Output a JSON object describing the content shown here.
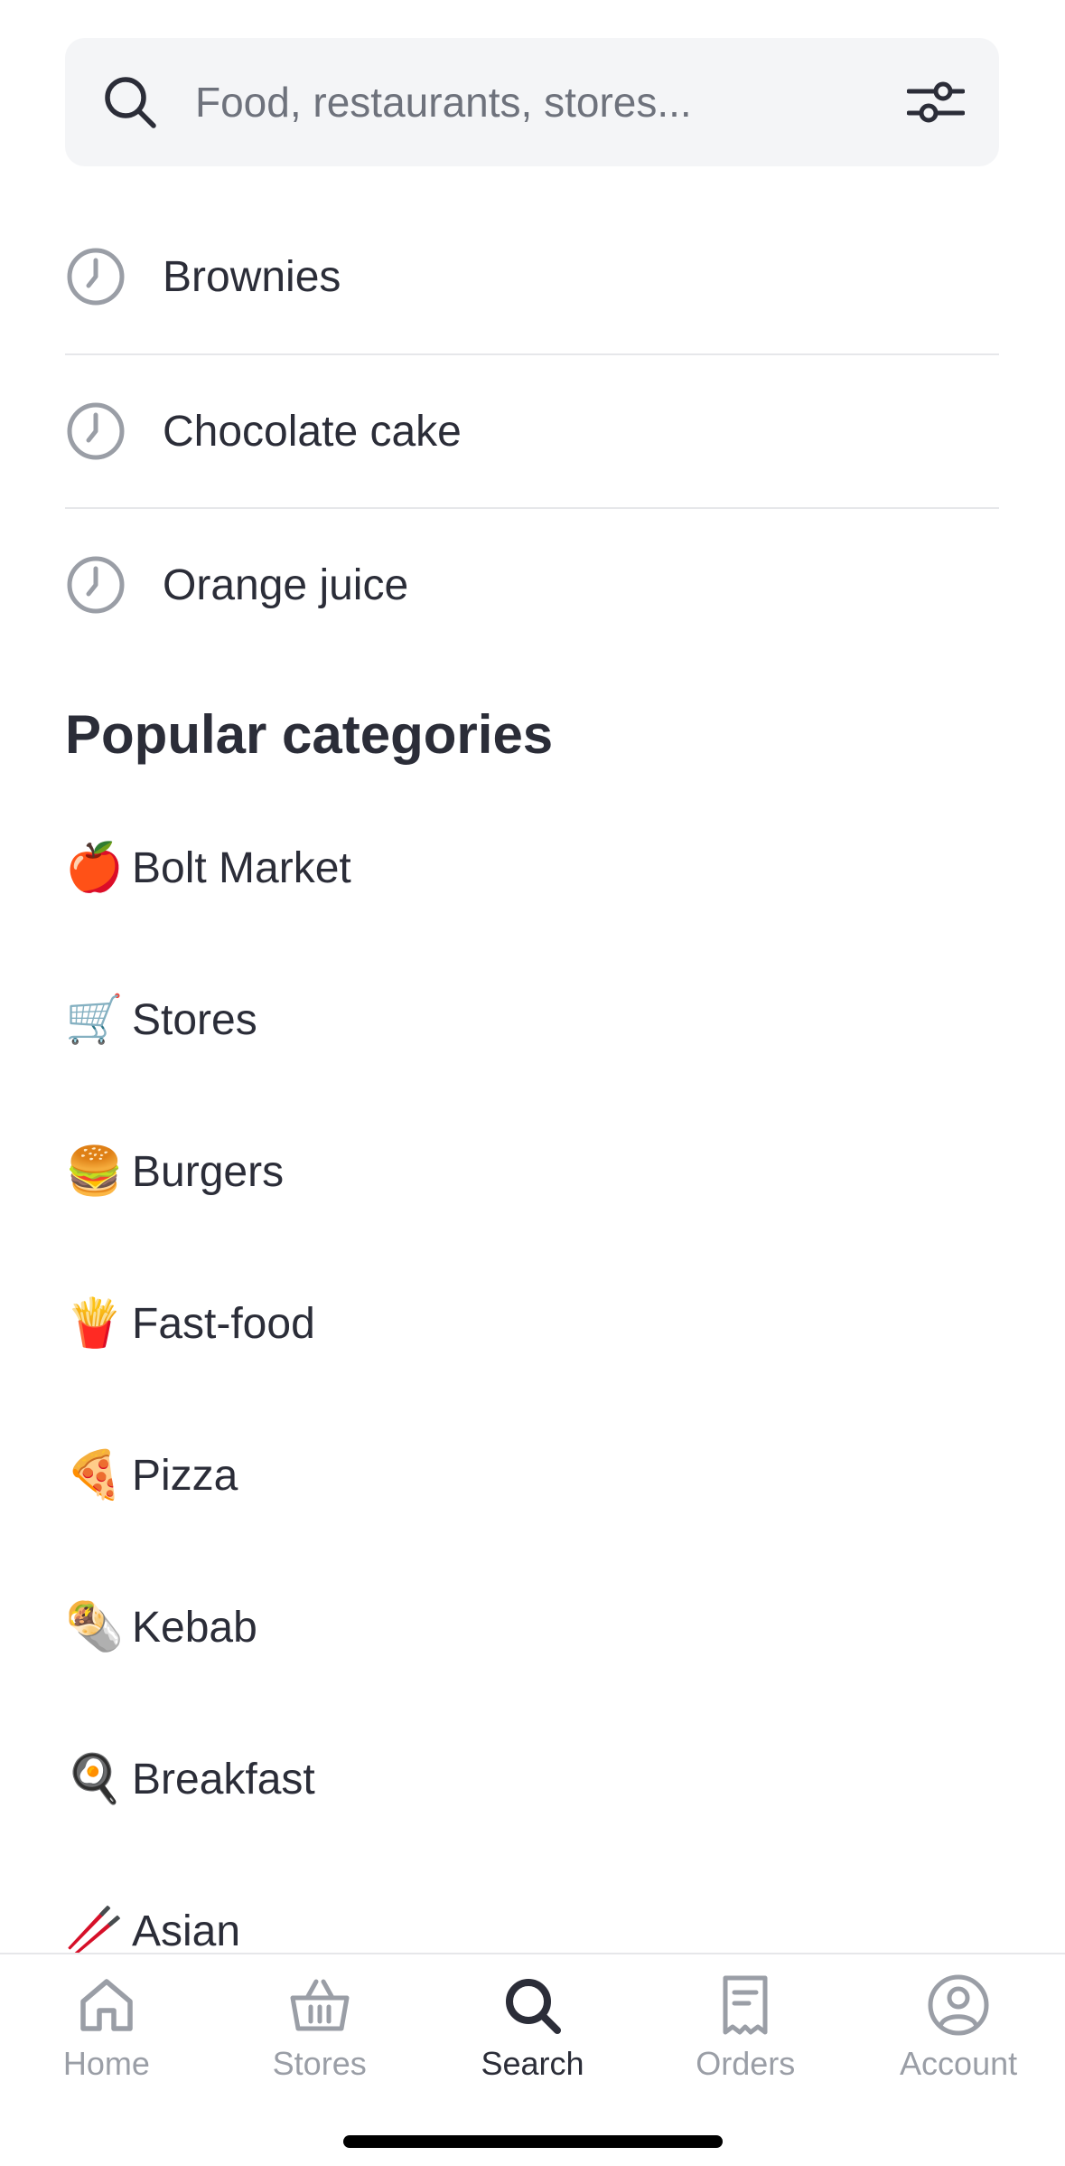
{
  "search": {
    "placeholder": "Food, restaurants, stores...",
    "icon": "search-icon",
    "filter_icon": "sliders-icon"
  },
  "recent_searches": [
    {
      "label": "Brownies",
      "icon": "clock-icon"
    },
    {
      "label": "Chocolate cake",
      "icon": "clock-icon"
    },
    {
      "label": "Orange juice",
      "icon": "clock-icon"
    }
  ],
  "popular": {
    "title": "Popular categories",
    "items": [
      {
        "emoji": "🍎",
        "label": "Bolt Market"
      },
      {
        "emoji": "🛒",
        "label": "Stores"
      },
      {
        "emoji": "🍔",
        "label": "Burgers"
      },
      {
        "emoji": "🍟",
        "label": "Fast-food"
      },
      {
        "emoji": "🍕",
        "label": "Pizza"
      },
      {
        "emoji": "🌯",
        "label": "Kebab"
      },
      {
        "emoji": "🍳",
        "label": "Breakfast"
      },
      {
        "emoji": "🥢",
        "label": "Asian"
      }
    ]
  },
  "tab_bar": {
    "active": "Search",
    "tabs": [
      {
        "label": "Home",
        "icon": "home-icon"
      },
      {
        "label": "Stores",
        "icon": "basket-icon"
      },
      {
        "label": "Search",
        "icon": "search-icon"
      },
      {
        "label": "Orders",
        "icon": "receipt-icon"
      },
      {
        "label": "Account",
        "icon": "account-icon"
      }
    ]
  },
  "colors": {
    "text": "#2b2d38",
    "placeholder": "#6e727c",
    "inactive_tab": "#9a9ea6",
    "search_bg": "#f4f5f7",
    "divider": "#e6e7ea"
  }
}
